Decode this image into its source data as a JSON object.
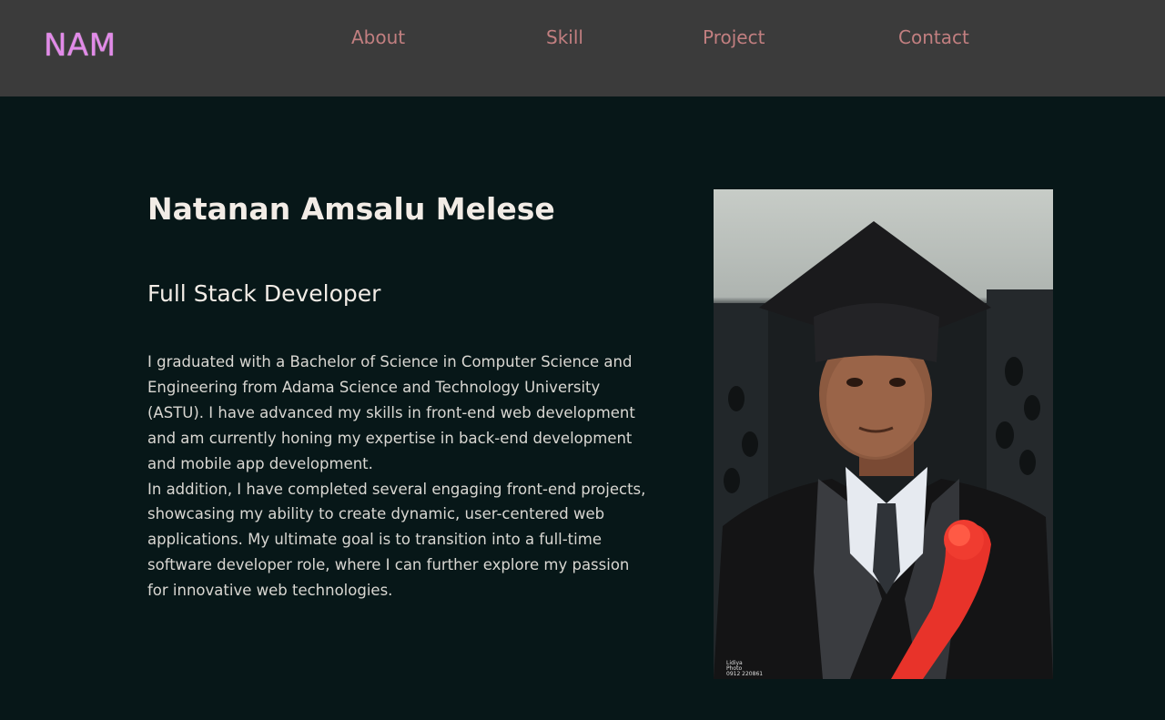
{
  "header": {
    "logo": "NAM",
    "links": [
      {
        "label": "About"
      },
      {
        "label": "Skill"
      },
      {
        "label": "Project"
      },
      {
        "label": "Contact"
      }
    ]
  },
  "hero": {
    "name": "Natanan Amsalu Melese",
    "role": "Full Stack Developer",
    "bio": [
      "I graduated with a Bachelor of Science in Computer Science and Engineering from Adama Science and Technology University (ASTU). I have advanced my skills in front-end web development and am currently honing my expertise in back-end development and mobile app development.",
      "In addition, I have completed several engaging front-end projects, showcasing my ability to create dynamic, user-centered web applications. My ultimate goal is to transition into a full-time software developer role, where I can further explore my passion for innovative web technologies."
    ],
    "photo_watermark": [
      "Lidiya",
      "Photo",
      "0912 220861"
    ]
  },
  "colors": {
    "background": "#071718",
    "nav_background": "#3b3b3b",
    "logo": "#e28ae9",
    "nav_link": "#c27f80",
    "heading": "#f2ece6",
    "body_text": "#d9d7d2"
  }
}
